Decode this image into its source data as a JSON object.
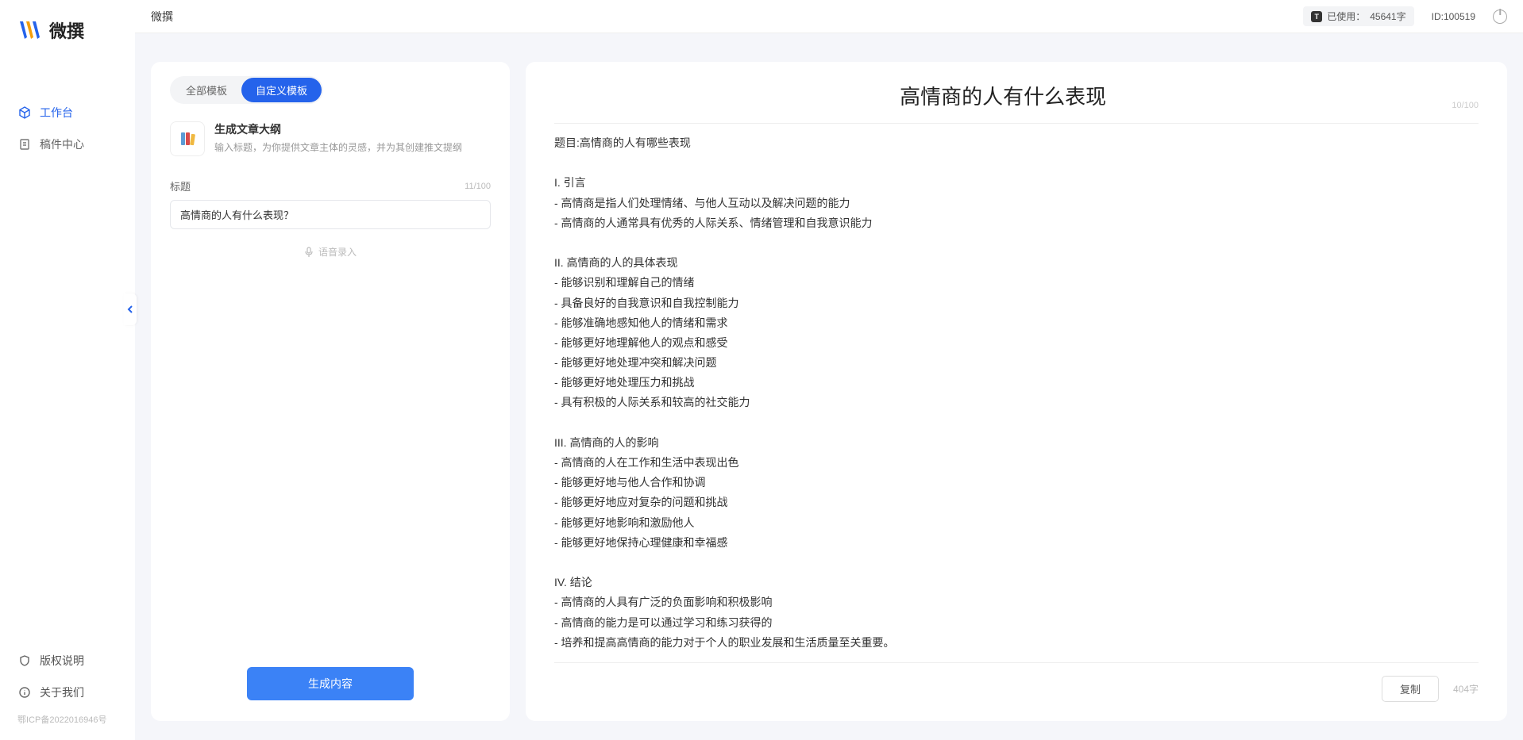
{
  "app": {
    "name": "微撰",
    "title": "微撰"
  },
  "topbar": {
    "usage_prefix": "已使用：",
    "usage_value": "45641字",
    "user_id": "ID:100519"
  },
  "sidebar": {
    "nav": [
      {
        "label": "工作台",
        "active": true
      },
      {
        "label": "稿件中心",
        "active": false
      }
    ],
    "bottom": [
      {
        "label": "版权说明"
      },
      {
        "label": "关于我们"
      }
    ],
    "icp": "鄂ICP备2022016946号"
  },
  "left": {
    "tabs": [
      {
        "label": "全部模板",
        "active": false
      },
      {
        "label": "自定义模板",
        "active": true
      }
    ],
    "template": {
      "title": "生成文章大纲",
      "desc": "输入标题，为你提供文章主体的灵感，并为其创建推文提纲",
      "icon": "📚"
    },
    "field_label": "标题",
    "char_count": "11/100",
    "input_value": "高情商的人有什么表现？",
    "voice_label": "语音录入",
    "generate_label": "生成内容"
  },
  "right": {
    "title": "高情商的人有什么表现",
    "title_count": "10/100",
    "body": "题目:高情商的人有哪些表现\n\nI. 引言\n- 高情商是指人们处理情绪、与他人互动以及解决问题的能力\n- 高情商的人通常具有优秀的人际关系、情绪管理和自我意识能力\n\nII. 高情商的人的具体表现\n- 能够识别和理解自己的情绪\n- 具备良好的自我意识和自我控制能力\n- 能够准确地感知他人的情绪和需求\n- 能够更好地理解他人的观点和感受\n- 能够更好地处理冲突和解决问题\n- 能够更好地处理压力和挑战\n- 具有积极的人际关系和较高的社交能力\n\nIII. 高情商的人的影响\n- 高情商的人在工作和生活中表现出色\n- 能够更好地与他人合作和协调\n- 能够更好地应对复杂的问题和挑战\n- 能够更好地影响和激励他人\n- 能够更好地保持心理健康和幸福感\n\nIV. 结论\n- 高情商的人具有广泛的负面影响和积极影响\n- 高情商的能力是可以通过学习和练习获得的\n- 培养和提高高情商的能力对于个人的职业发展和生活质量至关重要。",
    "copy_label": "复制",
    "word_count": "404字"
  }
}
